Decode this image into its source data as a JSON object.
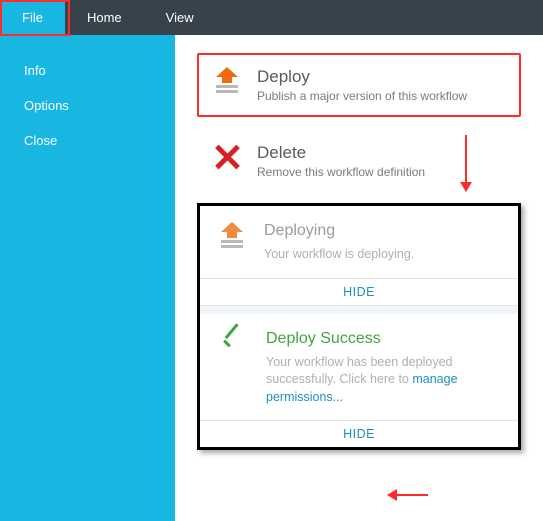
{
  "topbar": {
    "file": "File",
    "home": "Home",
    "view": "View"
  },
  "sidebar": {
    "info": "Info",
    "options": "Options",
    "close": "Close"
  },
  "deploy": {
    "title": "Deploy",
    "sub": "Publish a major version of this workflow"
  },
  "delete": {
    "title": "Delete",
    "sub": "Remove this workflow definition"
  },
  "status": {
    "deploying": {
      "title": "Deploying",
      "desc": "Your workflow is deploying.",
      "hide": "HIDE"
    },
    "success": {
      "title": "Deploy Success",
      "desc_prefix": "Your workflow has been deployed successfully. Click here to ",
      "link": "manage permissions...",
      "hide": "HIDE"
    }
  }
}
